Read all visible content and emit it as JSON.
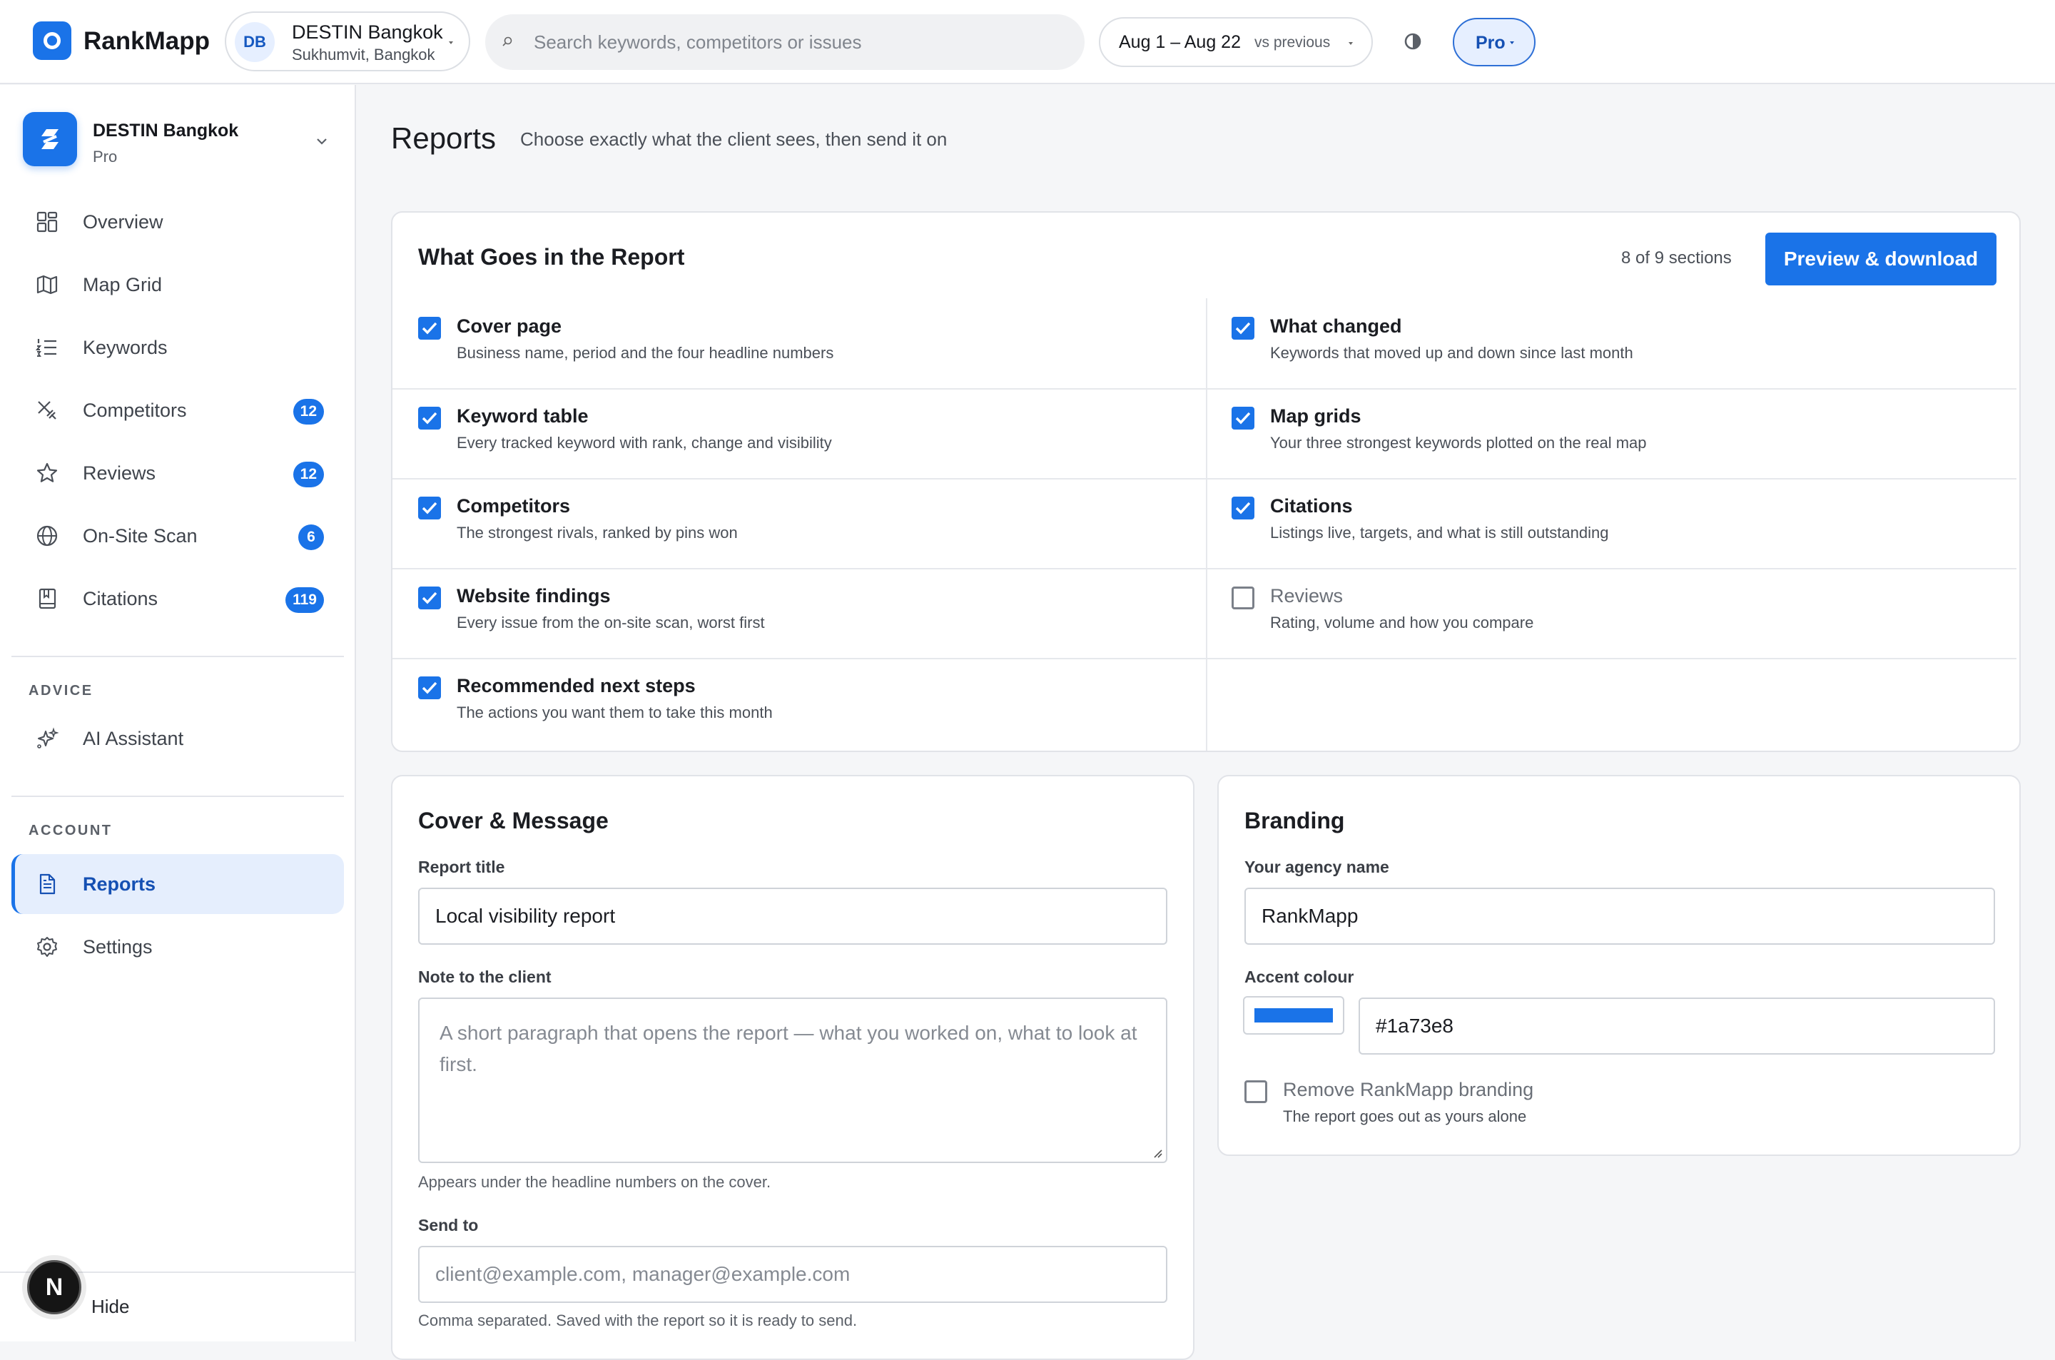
{
  "app": {
    "name": "RankMapp"
  },
  "topbar": {
    "business": {
      "initials": "DB",
      "name": "DESTIN Bangkok",
      "location": "Sukhumvit, Bangkok"
    },
    "search_placeholder": "Search keywords, competitors or issues",
    "date_range": "Aug 1 – Aug 22",
    "compare": "vs previous",
    "plan_pill": "Pro"
  },
  "sidebar": {
    "workspace": {
      "name": "DESTIN Bangkok",
      "plan": "Pro"
    },
    "items": [
      {
        "label": "Overview",
        "icon": "grid-icon"
      },
      {
        "label": "Map Grid",
        "icon": "map-icon"
      },
      {
        "label": "Keywords",
        "icon": "list-icon"
      },
      {
        "label": "Competitors",
        "icon": "swords-icon",
        "badge": "12"
      },
      {
        "label": "Reviews",
        "icon": "star-icon",
        "badge": "12"
      },
      {
        "label": "On-Site Scan",
        "icon": "globe-icon",
        "badge": "6"
      },
      {
        "label": "Citations",
        "icon": "book-icon",
        "badge": "119"
      }
    ],
    "advice_label": "ADVICE",
    "advice_items": [
      {
        "label": "AI Assistant",
        "icon": "sparkles-icon"
      }
    ],
    "account_label": "ACCOUNT",
    "account_items": [
      {
        "label": "Reports",
        "icon": "document-icon",
        "active": true
      },
      {
        "label": "Settings",
        "icon": "gear-icon"
      }
    ],
    "dev_badge": "N",
    "hide_label": "Hide"
  },
  "page": {
    "title": "Reports",
    "subtitle": "Choose exactly what the client sees, then send it on"
  },
  "report_sections": {
    "title": "What Goes in the Report",
    "count_text": "8 of 9 sections",
    "preview_button": "Preview & download",
    "options": [
      {
        "title": "Cover page",
        "desc": "Business name, period and the four headline numbers",
        "checked": true
      },
      {
        "title": "What changed",
        "desc": "Keywords that moved up and down since last month",
        "checked": true
      },
      {
        "title": "Keyword table",
        "desc": "Every tracked keyword with rank, change and visibility",
        "checked": true
      },
      {
        "title": "Map grids",
        "desc": "Your three strongest keywords plotted on the real map",
        "checked": true
      },
      {
        "title": "Competitors",
        "desc": "The strongest rivals, ranked by pins won",
        "checked": true
      },
      {
        "title": "Citations",
        "desc": "Listings live, targets, and what is still outstanding",
        "checked": true
      },
      {
        "title": "Website findings",
        "desc": "Every issue from the on-site scan, worst first",
        "checked": true
      },
      {
        "title": "Reviews",
        "desc": "Rating, volume and how you compare",
        "checked": false
      },
      {
        "title": "Recommended next steps",
        "desc": "The actions you want them to take this month",
        "checked": true
      }
    ]
  },
  "cover": {
    "title": "Cover & Message",
    "report_title_label": "Report title",
    "report_title_value": "Local visibility report",
    "note_label": "Note to the client",
    "note_placeholder": "A short paragraph that opens the report — what you worked on, what to look at first.",
    "note_help": "Appears under the headline numbers on the cover.",
    "send_label": "Send to",
    "send_placeholder": "client@example.com, manager@example.com",
    "send_help": "Comma separated. Saved with the report so it is ready to send."
  },
  "branding": {
    "title": "Branding",
    "agency_label": "Your agency name",
    "agency_value": "RankMapp",
    "accent_label": "Accent colour",
    "accent_value": "#1a73e8",
    "remove_label": "Remove RankMapp branding",
    "remove_desc": "The report goes out as yours alone",
    "remove_checked": false
  },
  "colors": {
    "accent": "#1a73e8",
    "badge": "#1a73e8",
    "active_bg": "#e5eefd"
  }
}
